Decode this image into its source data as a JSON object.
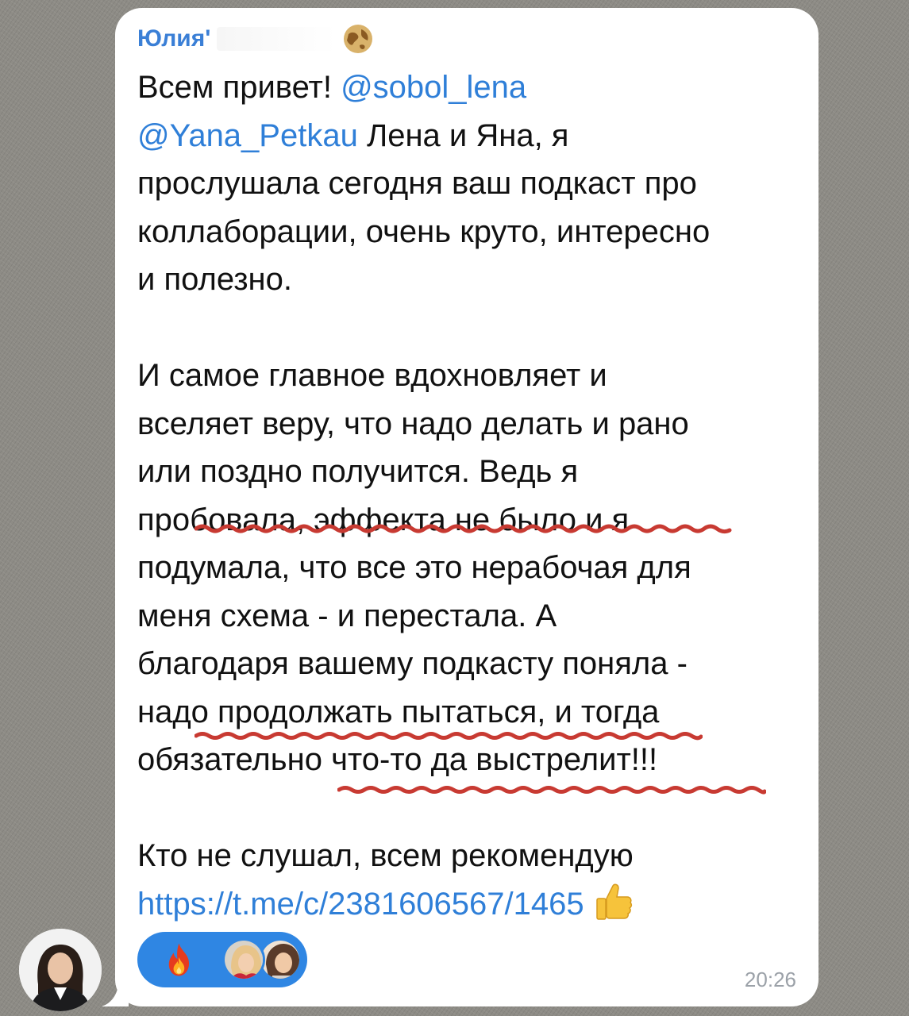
{
  "message": {
    "sender_name": "Юлия",
    "sender_name_suffix": "'",
    "lines": [
      {
        "segments": [
          {
            "text": "Всем привет! ",
            "kind": "text"
          },
          {
            "text": "@sobol_lena",
            "kind": "mention"
          }
        ]
      },
      {
        "segments": [
          {
            "text": "@Yana_Petkau",
            "kind": "mention"
          },
          {
            "text": " Лена и Яна, я",
            "kind": "text"
          }
        ]
      },
      {
        "segments": [
          {
            "text": "прослушала сегодня ваш подкаст про",
            "kind": "text"
          }
        ]
      },
      {
        "segments": [
          {
            "text": "коллаборации, очень круто, интересно",
            "kind": "text"
          }
        ]
      },
      {
        "segments": [
          {
            "text": "и полезно.",
            "kind": "text"
          }
        ]
      },
      {
        "segments": [
          {
            "text": "",
            "kind": "text"
          }
        ]
      },
      {
        "segments": [
          {
            "text": "И самое главное вдохновляет и",
            "kind": "text"
          }
        ]
      },
      {
        "segments": [
          {
            "text": "вселяет веру, что надо делать и рано",
            "kind": "text"
          }
        ]
      },
      {
        "segments": [
          {
            "text": "или поздно получится. Ведь я",
            "kind": "text"
          }
        ]
      },
      {
        "segments": [
          {
            "text": "пробовала, эффекта не было и я",
            "kind": "text"
          }
        ]
      },
      {
        "segments": [
          {
            "text": "подумала, что все это нерабочая для",
            "kind": "text"
          }
        ]
      },
      {
        "segments": [
          {
            "text": "меня схема - и перестала. А",
            "kind": "text"
          }
        ]
      },
      {
        "segments": [
          {
            "text": "благодаря вашему подкасту поняла -",
            "kind": "text"
          }
        ]
      },
      {
        "segments": [
          {
            "text": "надо продолжать пытаться, и тогда",
            "kind": "text"
          }
        ]
      },
      {
        "segments": [
          {
            "text": "обязательно что-то да выстрелит!!!",
            "kind": "text"
          }
        ]
      },
      {
        "segments": [
          {
            "text": "",
            "kind": "text"
          }
        ]
      },
      {
        "segments": [
          {
            "text": "Кто не слушал, всем рекомендую",
            "kind": "text"
          }
        ]
      },
      {
        "segments": [
          {
            "text": "https://t.me/c/2381606567/1465",
            "kind": "link"
          }
        ],
        "trailing_icon": "thumbs-up-icon"
      }
    ],
    "time": "20:26"
  },
  "reactions": {
    "emoji_icon": "fire-icon",
    "reactor_avatars": [
      "reactor-avatar-1",
      "reactor-avatar-2"
    ]
  },
  "colors": {
    "mention": "#2f7fd8",
    "sender": "#3a7fd6",
    "reaction_pill": "#2f86e3",
    "underline_marks": "#c83a32",
    "time": "#9ba1a8"
  }
}
